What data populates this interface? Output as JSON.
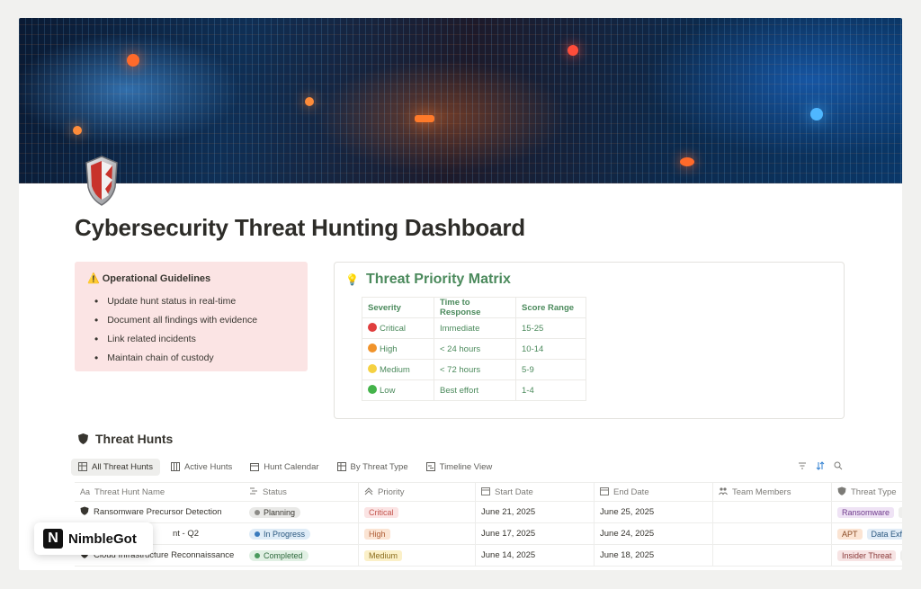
{
  "page": {
    "title": "Cybersecurity Threat Hunting Dashboard"
  },
  "callout": {
    "icon": "warning-icon",
    "heading": "⚠️ Operational Guidelines",
    "items": [
      "Update hunt status in real-time",
      "Document all findings with evidence",
      "Link related incidents",
      "Maintain chain of custody"
    ],
    "background": "#fbe4e4"
  },
  "matrix": {
    "icon": "lightbulb-icon",
    "title": "Threat Priority Matrix",
    "headers": [
      "Severity",
      "Time to Response",
      "Score Range"
    ],
    "rows": [
      {
        "dot": "#e03e3e",
        "severity": "Critical",
        "time": "Immediate",
        "score": "15-25"
      },
      {
        "dot": "#f0932b",
        "severity": "High",
        "time": "< 24 hours",
        "score": "10-14"
      },
      {
        "dot": "#f5d142",
        "severity": "Medium",
        "time": "< 72 hours",
        "score": "5-9"
      },
      {
        "dot": "#44b34a",
        "severity": "Low",
        "time": "Best effort",
        "score": "1-4"
      }
    ],
    "accent": "#4b8a5c"
  },
  "hunts": {
    "title": "Threat Hunts",
    "tabs": [
      {
        "label": "All Threat Hunts",
        "active": true
      },
      {
        "label": "Active Hunts",
        "active": false
      },
      {
        "label": "Hunt Calendar",
        "active": false
      },
      {
        "label": "By Threat Type",
        "active": false
      },
      {
        "label": "Timeline View",
        "active": false
      }
    ],
    "columns": [
      "Threat Hunt Name",
      "Status",
      "Priority",
      "Start Date",
      "End Date",
      "Team Members",
      "Threat Type"
    ],
    "rows": [
      {
        "name": "Ransomware Precursor Detection",
        "status": "Planning",
        "status_bg": "#e9e9e7",
        "status_dot": "#8c8b87",
        "priority": "Critical",
        "priority_bg": "#fbe4e4",
        "priority_fg": "#c4554d",
        "start": "June 21, 2025",
        "end": "June 25, 2025",
        "types": [
          {
            "label": "Ransomware",
            "bg": "#efe3f5",
            "fg": "#6f3b8c"
          },
          {
            "label": "C",
            "bg": "#eeeeec",
            "fg": "#37352f"
          }
        ]
      },
      {
        "name": "nt - Q2",
        "status": "In Progress",
        "status_bg": "#dfecf7",
        "status_dot": "#3a7bbd",
        "priority": "High",
        "priority_bg": "#fbe4d3",
        "priority_fg": "#b0603a",
        "start": "June 17, 2025",
        "end": "June 24, 2025",
        "types": [
          {
            "label": "APT",
            "bg": "#fbe4d3",
            "fg": "#8a4b25"
          },
          {
            "label": "Data Exfil",
            "bg": "#e1ecf7",
            "fg": "#29567e"
          }
        ]
      },
      {
        "name": "Cloud Infrastructure Reconnaissance",
        "status": "Completed",
        "status_bg": "#e1f0e4",
        "status_dot": "#4b9a5e",
        "priority": "Medium",
        "priority_bg": "#fbf0c8",
        "priority_fg": "#8b6d1e",
        "start": "June 14, 2025",
        "end": "June 18, 2025",
        "types": [
          {
            "label": "Insider Threat",
            "bg": "#f7e4e4",
            "fg": "#8a3a3a"
          },
          {
            "label": "",
            "bg": "#eeeeec",
            "fg": "#37352f"
          }
        ]
      }
    ]
  },
  "watermark": {
    "mark": "N",
    "text": "NimbleGot"
  }
}
